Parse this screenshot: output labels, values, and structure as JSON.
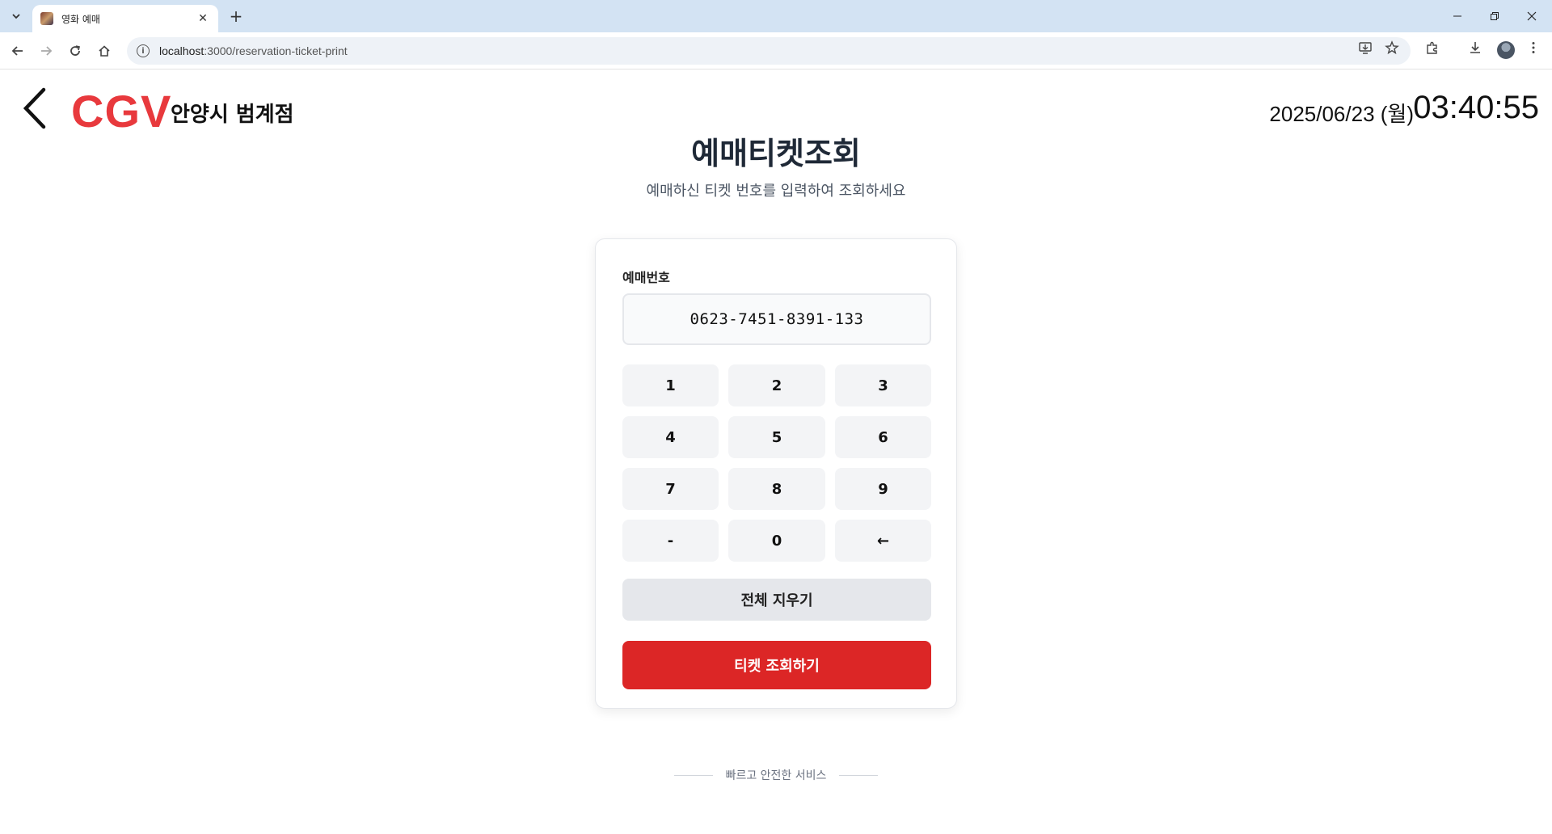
{
  "browser": {
    "tab_title": "영화 예매",
    "url_host": "localhost",
    "url_rest": ":3000/reservation-ticket-print"
  },
  "header": {
    "logo": "CGV",
    "branch": "안양시 범계점",
    "date": "2025/06/23 (월)",
    "time": "03:40:55"
  },
  "main": {
    "title": "예매티켓조회",
    "subtitle": "예매하신 티켓 번호를 입력하여 조회하세요",
    "field_label": "예매번호",
    "field_value": "0623-7451-8391-133",
    "keys": [
      "1",
      "2",
      "3",
      "4",
      "5",
      "6",
      "7",
      "8",
      "9",
      "-",
      "0",
      "←"
    ],
    "clear_label": "전체 지우기",
    "submit_label": "티켓 조회하기"
  },
  "footer": {
    "text": "빠르고 안전한 서비스"
  },
  "colors": {
    "brand": "#e8393d",
    "submit": "#dc2626",
    "chrome": "#d3e3f3"
  }
}
